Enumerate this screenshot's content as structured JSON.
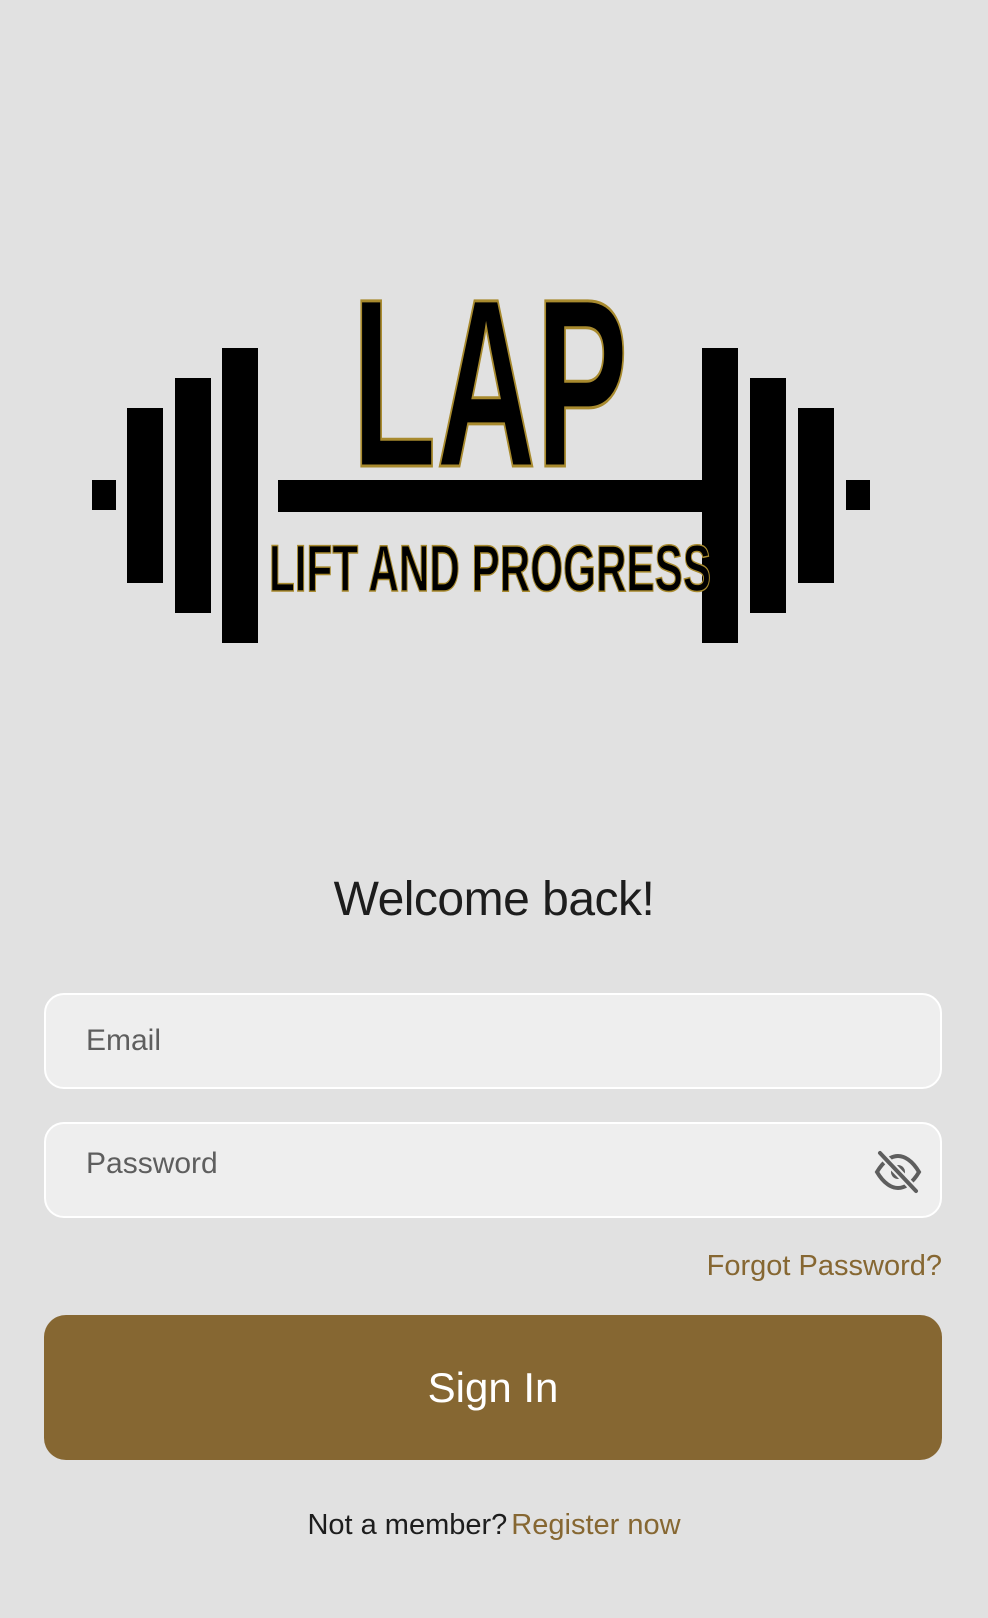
{
  "logo": {
    "acronym": "LAP",
    "tagline": "LIFT AND PROGRESS",
    "icon": "barbell-logo",
    "colors": {
      "fill": "#000000",
      "outline": "#a88a2e"
    }
  },
  "heading": "Welcome back!",
  "form": {
    "email": {
      "placeholder": "Email",
      "value": ""
    },
    "password": {
      "placeholder": "Password",
      "value": "",
      "toggle_icon": "eye-off-icon"
    },
    "forgot_label": "Forgot Password?",
    "submit_label": "Sign In"
  },
  "footer": {
    "prompt": "Not a member?",
    "register_label": "Register now"
  },
  "colors": {
    "background": "#e1e1e1",
    "accent": "#866732",
    "field_bg": "#eeeeee",
    "text": "#1d1d1d"
  }
}
